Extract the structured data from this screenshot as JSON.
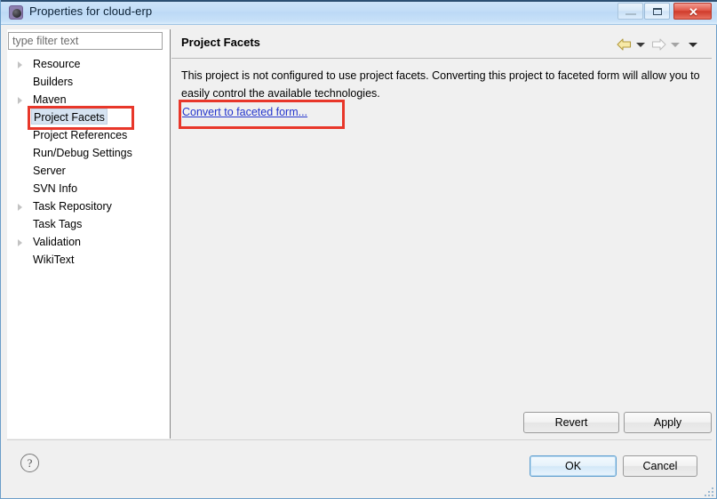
{
  "window": {
    "title": "Properties for cloud-erp",
    "icon": "eclipse-properties-icon",
    "controls": {
      "minimize_label": "",
      "maximize_label": "",
      "close_label": "✕"
    }
  },
  "sidebar": {
    "filter": {
      "placeholder": "type filter text",
      "value": ""
    },
    "items": [
      {
        "label": "Resource",
        "expandable": true,
        "selected": false
      },
      {
        "label": "Builders",
        "expandable": false,
        "selected": false
      },
      {
        "label": "Maven",
        "expandable": true,
        "selected": false
      },
      {
        "label": "Project Facets",
        "expandable": false,
        "selected": true
      },
      {
        "label": "Project References",
        "expandable": false,
        "selected": false
      },
      {
        "label": "Run/Debug Settings",
        "expandable": false,
        "selected": false
      },
      {
        "label": "Server",
        "expandable": false,
        "selected": false
      },
      {
        "label": "SVN Info",
        "expandable": false,
        "selected": false
      },
      {
        "label": "Task Repository",
        "expandable": true,
        "selected": false
      },
      {
        "label": "Task Tags",
        "expandable": false,
        "selected": false
      },
      {
        "label": "Validation",
        "expandable": true,
        "selected": false
      },
      {
        "label": "WikiText",
        "expandable": false,
        "selected": false
      }
    ]
  },
  "content": {
    "title": "Project Facets",
    "description": "This project is not configured to use project facets. Converting this project to faceted form will allow you to easily control the available technologies.",
    "link_label": "Convert to faceted form...",
    "nav": {
      "back_icon": "arrow-left-icon",
      "back_menu_icon": "chevron-down-icon",
      "forward_icon": "arrow-right-icon",
      "forward_menu_icon": "chevron-down-icon",
      "overflow_menu_icon": "chevron-down-icon"
    }
  },
  "buttons": {
    "revert": "Revert",
    "apply": "Apply",
    "ok": "OK",
    "cancel": "Cancel"
  },
  "footer": {
    "help_icon": "question-mark-icon",
    "help_glyph": "?"
  },
  "annotations": {
    "color": "#e8372a",
    "boxes": [
      {
        "target": "sidebar-item-project-facets"
      },
      {
        "target": "convert-to-faceted-form-link"
      }
    ]
  },
  "colors": {
    "title_bar": "#c2ddf7",
    "window_border": "#6b9ec9",
    "panel_bg": "#f0f0f0",
    "tree_bg": "#ffffff",
    "selection": "#d6e3f1",
    "link": "#2536cd",
    "annotation": "#e8372a",
    "close_button": "#cf3c2c"
  }
}
